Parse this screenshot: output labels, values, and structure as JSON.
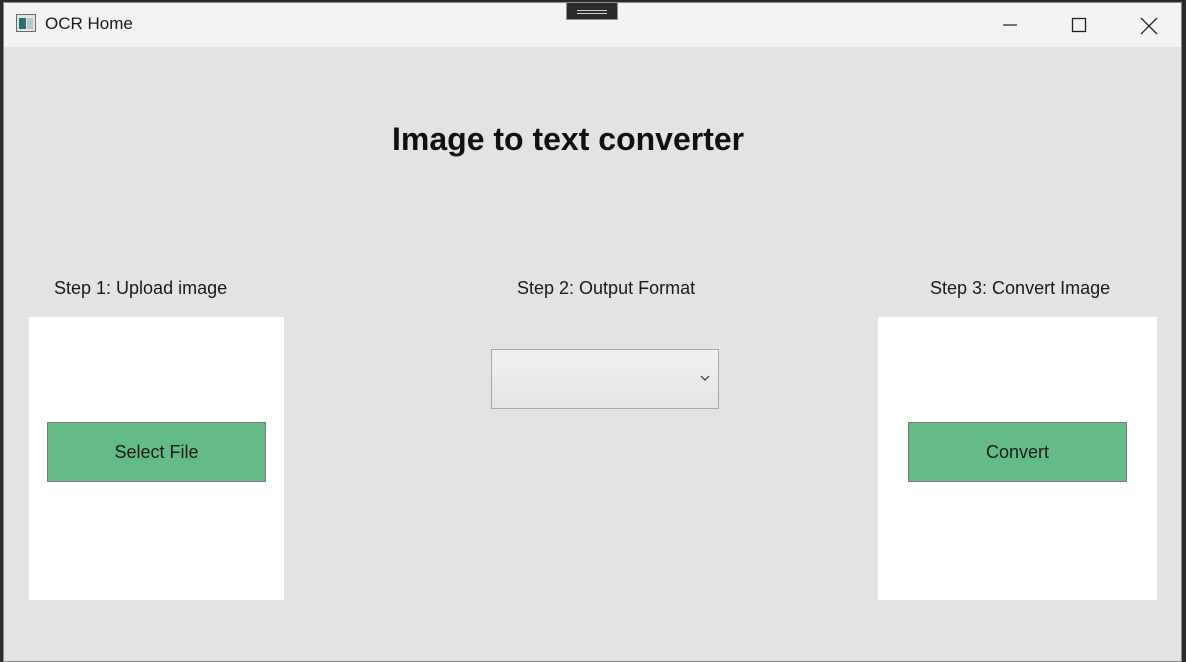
{
  "window": {
    "title": "OCR Home"
  },
  "main": {
    "heading": "Image to text converter",
    "steps": [
      {
        "label": "Step 1: Upload image",
        "button": "Select File"
      },
      {
        "label": "Step 2: Output Format",
        "selected": ""
      },
      {
        "label": "Step 3: Convert Image",
        "button": "Convert"
      }
    ]
  },
  "colors": {
    "accent_button": "#64bb85",
    "window_bg": "#e3e3e3",
    "panel_bg": "#ffffff"
  },
  "icons": [
    "app-icon",
    "minimize-icon",
    "maximize-icon",
    "close-icon",
    "chevron-down-icon"
  ]
}
